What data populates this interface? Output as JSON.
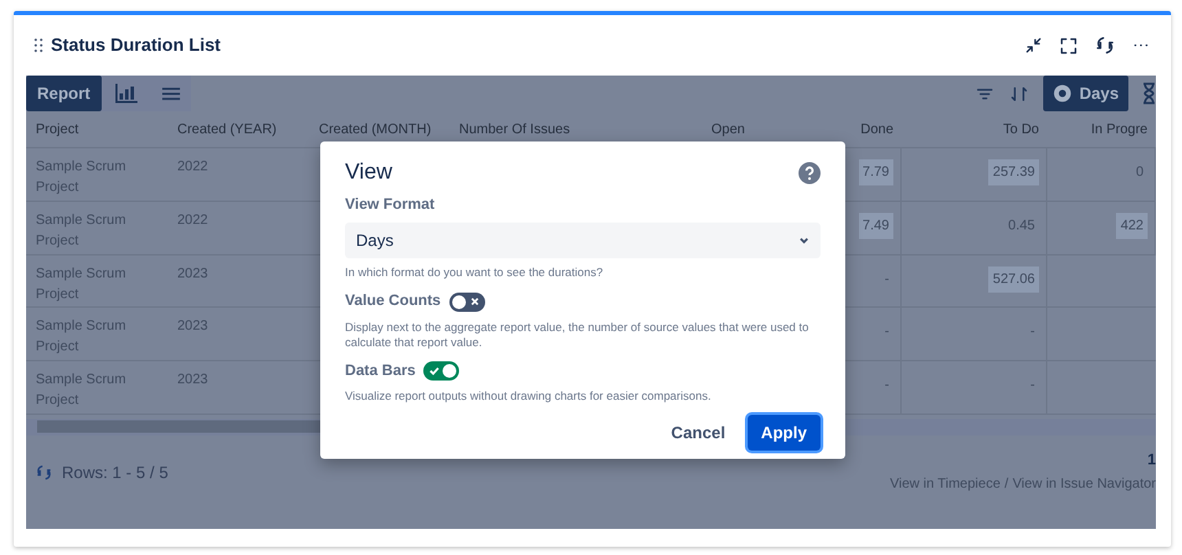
{
  "widget": {
    "title": "Status Duration List"
  },
  "view_tabs": [
    {
      "kind": "report",
      "label": "Report",
      "selected": true
    },
    {
      "kind": "chart",
      "selected": false
    },
    {
      "kind": "list",
      "selected": false
    }
  ],
  "format_button": {
    "label": "Days"
  },
  "table": {
    "columns": [
      "Project",
      "Created (YEAR)",
      "Created (MONTH)",
      "Number Of Issues",
      "Open",
      "Done",
      "To Do",
      "In Progre"
    ],
    "rows": [
      {
        "project": "Sample Scrum Project",
        "year": "2022",
        "done": {
          "text": "7.79",
          "bar": true
        },
        "to_do": {
          "text": "257.39",
          "bar": true
        },
        "in_progress": {
          "text": "0",
          "bar": false
        }
      },
      {
        "project": "Sample Scrum Project",
        "year": "2022",
        "done": {
          "text": "7.49",
          "bar": true
        },
        "to_do": {
          "text": "0.45",
          "bar": false
        },
        "in_progress": {
          "text": "422",
          "bar": true
        }
      },
      {
        "project": "Sample Scrum Project",
        "year": "2023",
        "done": {
          "text": "-",
          "bar": false
        },
        "to_do": {
          "text": "527.06",
          "bar": true
        }
      },
      {
        "project": "Sample Scrum Project",
        "year": "2023",
        "done": {
          "text": "-",
          "bar": false
        },
        "to_do": {
          "text": "-",
          "bar": false
        }
      },
      {
        "project": "Sample Scrum Project",
        "year": "2023",
        "done": {
          "text": "-",
          "bar": false
        },
        "to_do": {
          "text": "-",
          "bar": false
        }
      }
    ]
  },
  "footer": {
    "rows_label": "Rows: 1 - 5 / 5",
    "page": "1",
    "links": [
      "View in Timepiece",
      "View in Issue Navigator"
    ],
    "separator": "/"
  },
  "dialog": {
    "title": "View",
    "fields": [
      {
        "kind": "select",
        "label": "View Format",
        "value": "Days",
        "hint": "In which format do you want to see the durations?"
      },
      {
        "kind": "toggle",
        "label": "Value Counts",
        "on": false,
        "hint": "Display next to the aggregate report value, the number of source values that were used to calculate that report value."
      },
      {
        "kind": "toggle",
        "label": "Data Bars",
        "on": true,
        "hint": "Visualize report outputs without drawing charts for easier comparisons."
      }
    ],
    "buttons": [
      {
        "kind": "secondary",
        "label": "Cancel"
      },
      {
        "kind": "primary",
        "label": "Apply"
      }
    ]
  }
}
